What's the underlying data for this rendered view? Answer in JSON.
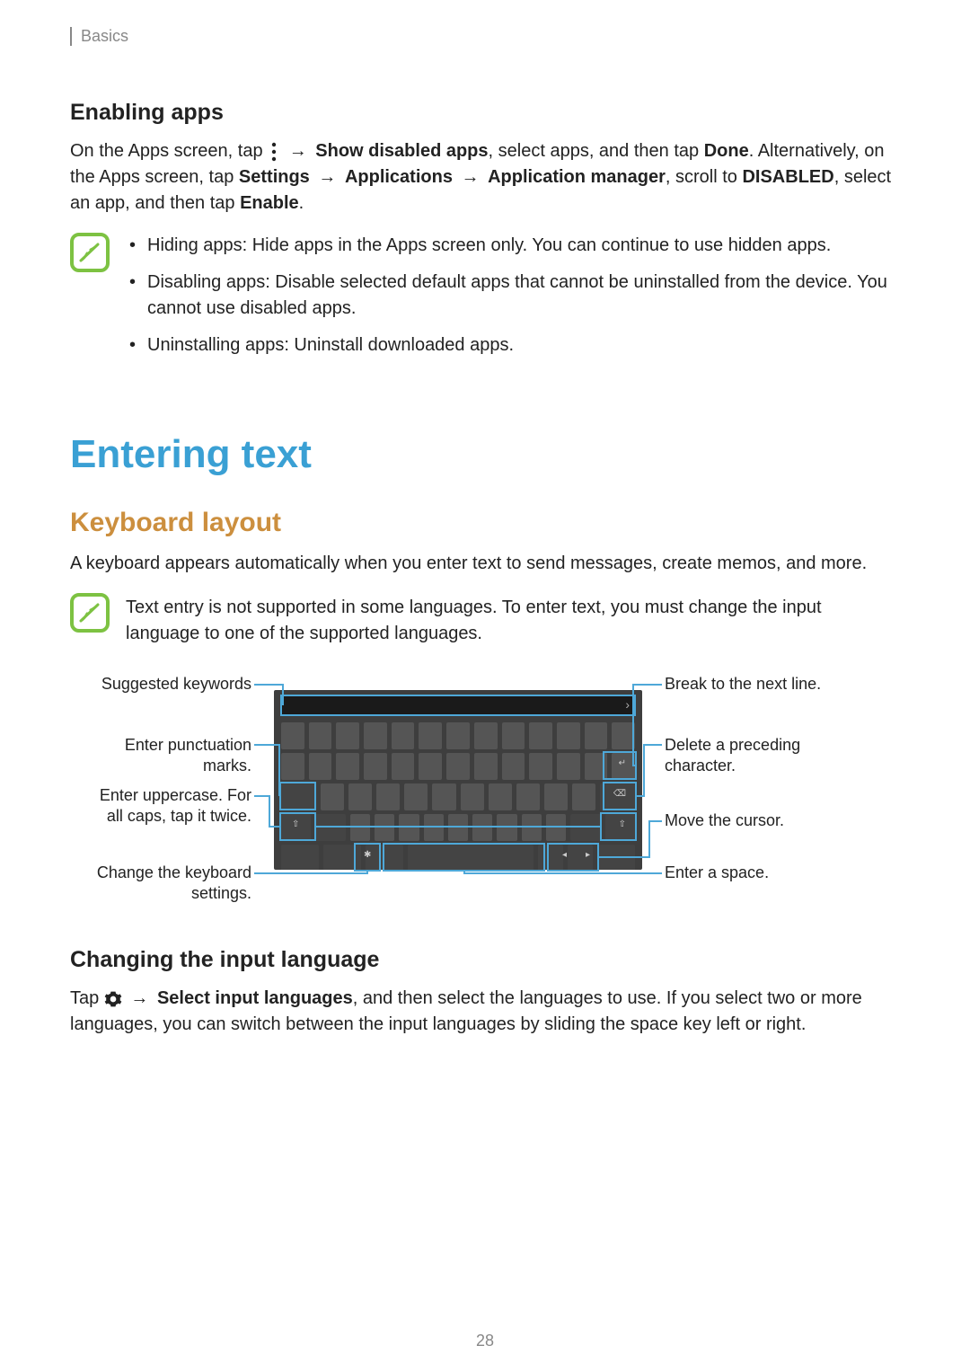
{
  "running_header": "Basics",
  "page_number": "28",
  "section_enabling": {
    "heading": "Enabling apps",
    "para_parts": [
      "On the Apps screen, tap ",
      " → ",
      "Show disabled apps",
      ", select apps, and then tap ",
      "Done",
      ". Alternatively, on the Apps screen, tap ",
      "Settings",
      " → ",
      "Applications",
      " → ",
      "Application manager",
      ", scroll to ",
      "DISABLED",
      ", select an app, and then tap ",
      "Enable",
      "."
    ],
    "note_bullets": [
      "Hiding apps: Hide apps in the Apps screen only. You can continue to use hidden apps.",
      "Disabling apps: Disable selected default apps that cannot be uninstalled from the device. You cannot use disabled apps.",
      "Uninstalling apps: Uninstall downloaded apps."
    ]
  },
  "section_entering_text": {
    "h1": "Entering text",
    "h2": "Keyboard layout",
    "intro": "A keyboard appears automatically when you enter text to send messages, create memos, and more.",
    "note_text": "Text entry is not supported in some languages. To enter text, you must change the input language to one of the supported languages.",
    "callouts_left": [
      "Suggested keywords",
      "Enter punctuation marks.",
      "Enter uppercase. For all caps, tap it twice.",
      "Change the keyboard settings."
    ],
    "callouts_right": [
      "Break to the next line.",
      "Delete a preceding character.",
      "Move the cursor.",
      "Enter a space."
    ]
  },
  "section_changing_lang": {
    "heading": "Changing the input language",
    "para_parts": [
      "Tap ",
      " → ",
      "Select input languages",
      ", and then select the languages to use. If you select two or more languages, you can switch between the input languages by sliding the space key left or right."
    ]
  }
}
